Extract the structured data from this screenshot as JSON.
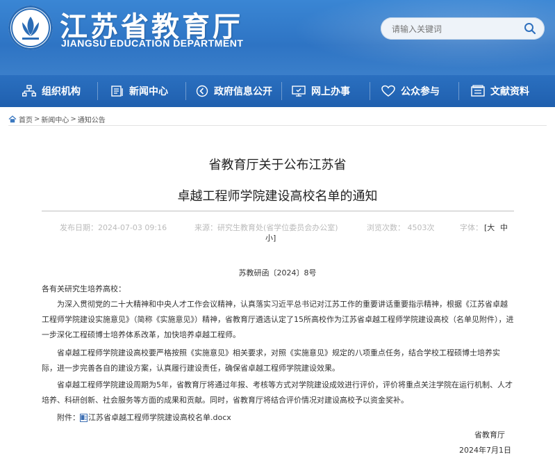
{
  "header": {
    "title_cn": "江苏省教育厅",
    "title_en": "JIANGSU EDUCATION DEPARTMENT",
    "search_placeholder": "请输入关键词"
  },
  "nav": {
    "items": [
      {
        "label": "组织机构",
        "icon": "org-chart-icon"
      },
      {
        "label": "新闻中心",
        "icon": "news-icon"
      },
      {
        "label": "政府信息公开",
        "icon": "government-info-icon"
      },
      {
        "label": "网上办事",
        "icon": "online-service-icon"
      },
      {
        "label": "公众参与",
        "icon": "heart-icon"
      },
      {
        "label": "文献资料",
        "icon": "document-icon"
      }
    ]
  },
  "breadcrumb": {
    "home": "首页",
    "sep": ">",
    "news": "新闻中心",
    "notice": "通知公告"
  },
  "article": {
    "title_line1": "省教育厅关于公布江苏省",
    "title_line2": "卓越工程师学院建设高校名单的通知",
    "meta": {
      "date": "发布日期：2024-07-03 09:16",
      "source": "来源：研究生教育处(省学位委员会办公室)",
      "views": "浏览次数：  4503次",
      "fontsize_label": "字体：",
      "font_large": "[大",
      "font_medium": "中",
      "font_small": "小]"
    },
    "doc_no": "苏教研函〔2024〕8号",
    "salutation": "各有关研究生培养高校：",
    "para1": "为深入贯彻党的二十大精神和中央人才工作会议精神，认真落实习近平总书记对江苏工作的重要讲话重要指示精神，根据《江苏省卓越工程师学院建设实施意见》（简称《实施意见》）精神，省教育厅遴选认定了15所高校作为江苏省卓越工程师学院建设高校（名单见附件），进一步深化工程硕博士培养体系改革，加快培养卓越工程师。",
    "para2": "省卓越工程师学院建设高校要严格按照《实施意见》相关要求，对照《实施意见》规定的八项重点任务，结合学校工程硕博士培养实际，进一步完善各自的建设方案，认真履行建设责任，确保省卓越工程师学院建设效果。",
    "para3": "省卓越工程师学院建设周期为5年，省教育厅将通过年报、考核等方式对学院建设成效进行评价，评价将重点关注学院在运行机制、人才培养、科研创新、社会服务等方面的成果和贡献。同时，省教育厅将结合评价情况对建设高校予以资金奖补。",
    "attachment_label": "附件：",
    "attachment_file": "江苏省卓越工程师学院建设高校名单.docx",
    "signer": "省教育厅",
    "date_signed": "2024年7月1日"
  }
}
